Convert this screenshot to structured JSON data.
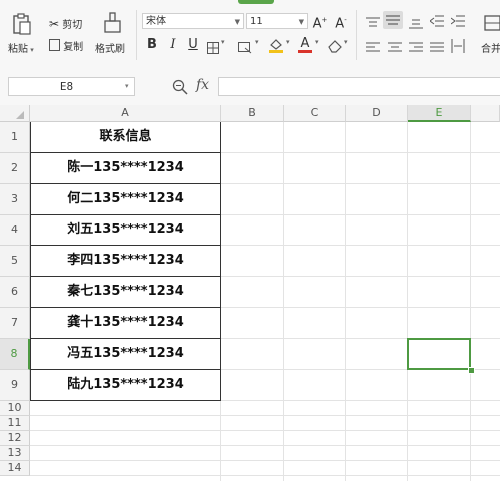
{
  "ribbon": {
    "paste_label": "粘贴",
    "cut_label": "剪切",
    "copy_label": "复制",
    "format_painter_label": "格式刷",
    "font_name": "宋体",
    "font_size": "11",
    "merge_label": "合并"
  },
  "formula_bar": {
    "name_box": "E8",
    "fx_label": "fx",
    "formula_value": ""
  },
  "grid": {
    "columns": [
      "A",
      "B",
      "C",
      "D",
      "E"
    ],
    "selected_column": "E",
    "selected_row": "8",
    "rows": [
      "1",
      "2",
      "3",
      "4",
      "5",
      "6",
      "7",
      "8",
      "9",
      "10",
      "11",
      "12",
      "13",
      "14"
    ],
    "cells": [
      "联系信息",
      "陈一135****1234",
      "何二135****1234",
      "刘五135****1234",
      "李四135****1234",
      "秦七135****1234",
      "龚十135****1234",
      "冯五135****1234",
      "陆九135****1234"
    ]
  },
  "colors": {
    "accent": "#4e9a42",
    "font_color_bar": "#d9342b",
    "fill_color_bar": "#f2c21a"
  }
}
